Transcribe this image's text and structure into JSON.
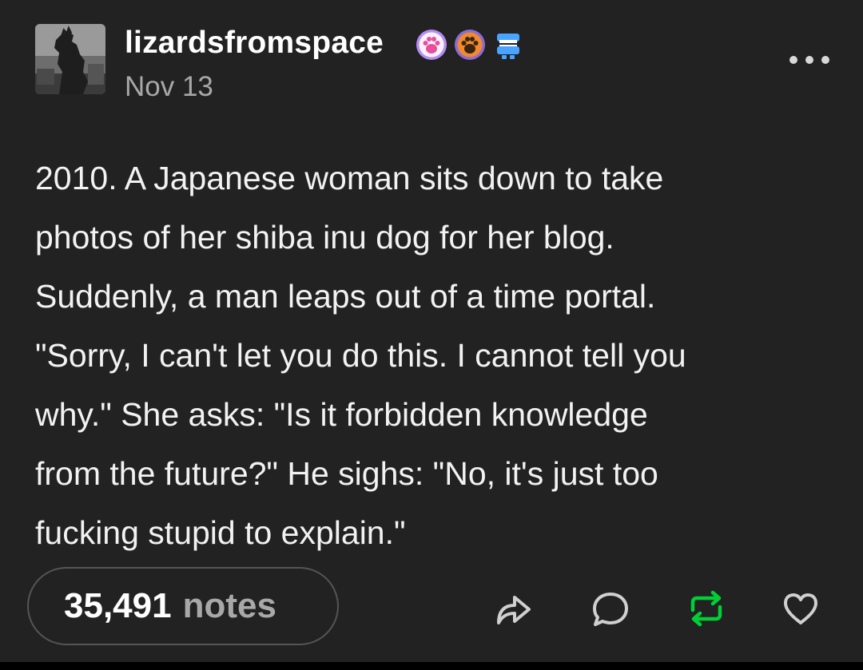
{
  "post": {
    "username": "lizardsfromspace",
    "date": "Nov 13",
    "avatar_icon": "godzilla-avatar",
    "badges": [
      "paw-badge-purple",
      "paw-badge-orange",
      "chattering-teeth-badge"
    ],
    "text": "2010. A Japanese woman sits down to take\nphotos of her shiba inu dog for her blog.\nSuddenly, a man leaps out of a time portal.\n\"Sorry, I can't let you do this. I cannot tell you\nwhy.\" She asks: \"Is it forbidden knowledge\nfrom the future?\" He sighs: \"No, it's just too\nfucking stupid to explain.\""
  },
  "footer": {
    "notes_count": "35,491",
    "notes_label": "notes",
    "actions": [
      "share-icon",
      "reply-icon",
      "reblog-icon",
      "heart-icon"
    ]
  },
  "colors": {
    "background": "#222222",
    "text": "#f2f2f2",
    "muted": "#a8a8a8",
    "reblog_green": "#00cf35",
    "pill_border": "#555555"
  }
}
